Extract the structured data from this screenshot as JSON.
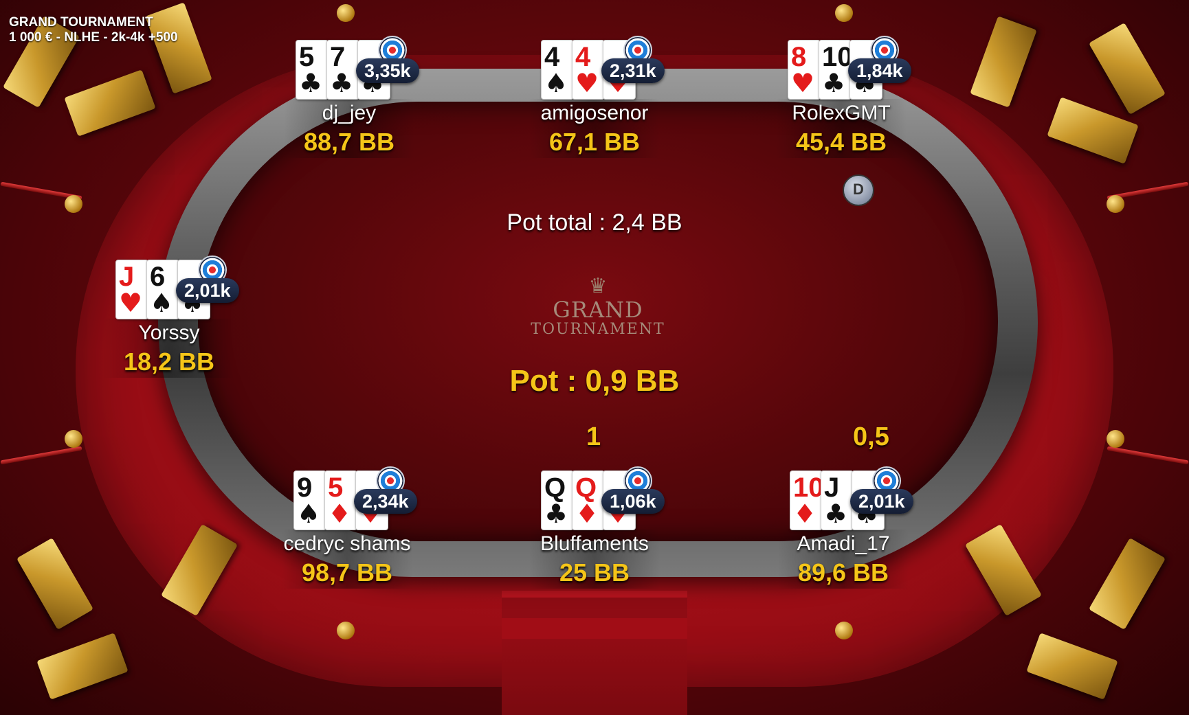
{
  "header": {
    "title": "GRAND TOURNAMENT",
    "subtitle": "1 000 € - NLHE - 2k-4k +500"
  },
  "logo": {
    "line1": "GRAND",
    "line2": "TOURNAMENT",
    "crest": "♛"
  },
  "pot_total": "Pot total : 2,4 BB",
  "pot": "Pot : 0,9 BB",
  "dealer_label": "D",
  "bets": {
    "bluffaments": "1",
    "amadi": "0,5"
  },
  "colors": {
    "gold": "#f5c518",
    "felt": "#55060a",
    "badge": "#1b2540"
  },
  "players": {
    "dj_jey": {
      "name": "dj_jey",
      "bb": "88,7 BB",
      "stack": "3,35k",
      "cards": [
        {
          "rank": "5",
          "suit": "♣",
          "color": "black"
        },
        {
          "rank": "7",
          "suit": "♣",
          "color": "black"
        },
        {
          "rank": "",
          "suit": "♣",
          "color": "black"
        }
      ]
    },
    "amigosenor": {
      "name": "amigosenor",
      "bb": "67,1 BB",
      "stack": "2,31k",
      "cards": [
        {
          "rank": "4",
          "suit": "♠",
          "color": "black"
        },
        {
          "rank": "4",
          "suit": "♥",
          "color": "red"
        },
        {
          "rank": "",
          "suit": "♥",
          "color": "red"
        }
      ]
    },
    "rolexgmt": {
      "name": "RolexGMT",
      "bb": "45,4 BB",
      "stack": "1,84k",
      "cards": [
        {
          "rank": "8",
          "suit": "♥",
          "color": "red"
        },
        {
          "rank": "10",
          "suit": "♣",
          "color": "black"
        },
        {
          "rank": "",
          "suit": "♣",
          "color": "black"
        }
      ]
    },
    "yorssy": {
      "name": "Yorssy",
      "bb": "18,2 BB",
      "stack": "2,01k",
      "cards": [
        {
          "rank": "J",
          "suit": "♥",
          "color": "red"
        },
        {
          "rank": "6",
          "suit": "♠",
          "color": "black"
        },
        {
          "rank": "",
          "suit": "♠",
          "color": "black"
        }
      ]
    },
    "cedryc": {
      "name": "cedryc shams",
      "bb": "98,7 BB",
      "stack": "2,34k",
      "cards": [
        {
          "rank": "9",
          "suit": "♠",
          "color": "black"
        },
        {
          "rank": "5",
          "suit": "♦",
          "color": "red"
        },
        {
          "rank": "",
          "suit": "♦",
          "color": "red"
        }
      ]
    },
    "bluffaments": {
      "name": "Bluffaments",
      "bb": "25 BB",
      "stack": "1,06k",
      "cards": [
        {
          "rank": "Q",
          "suit": "♣",
          "color": "black"
        },
        {
          "rank": "Q",
          "suit": "♦",
          "color": "red"
        },
        {
          "rank": "",
          "suit": "♦",
          "color": "red"
        }
      ]
    },
    "amadi": {
      "name": "Amadi_17",
      "bb": "89,6 BB",
      "stack": "2,01k",
      "cards": [
        {
          "rank": "10",
          "suit": "♦",
          "color": "red"
        },
        {
          "rank": "J",
          "suit": "♣",
          "color": "black"
        },
        {
          "rank": "",
          "suit": "♣",
          "color": "black"
        }
      ]
    }
  }
}
